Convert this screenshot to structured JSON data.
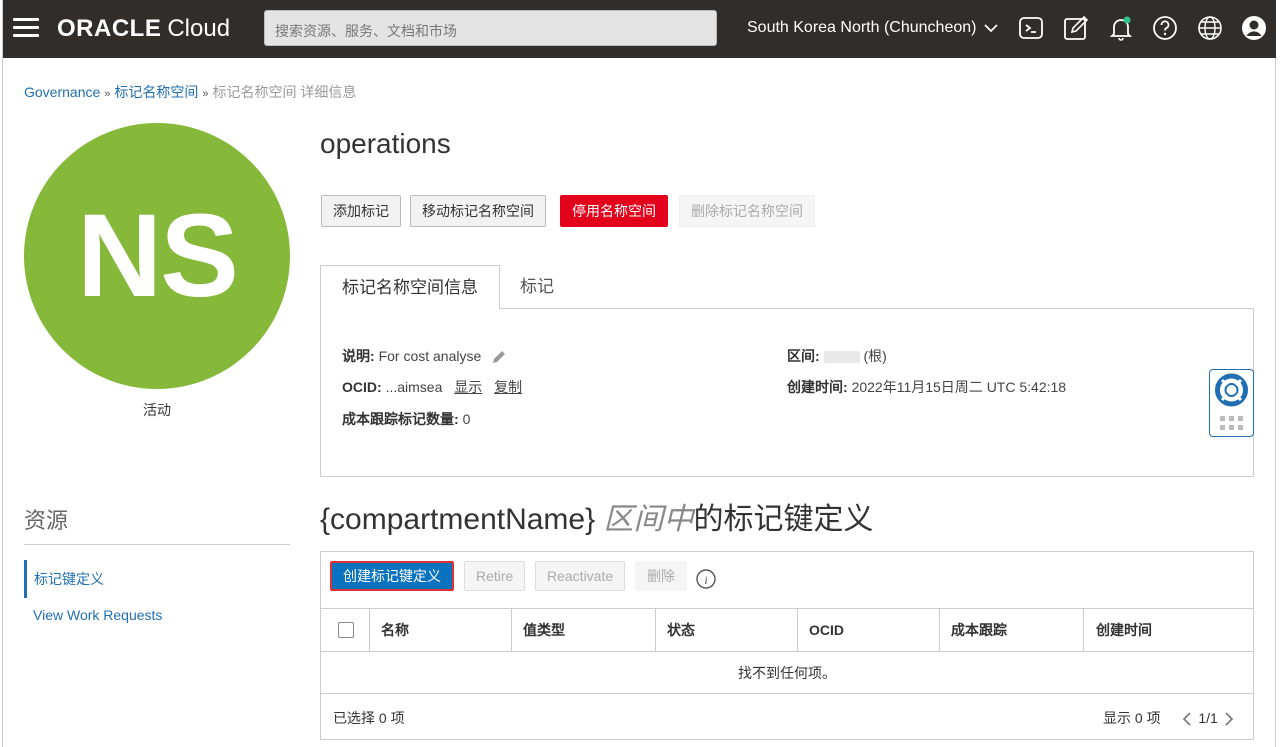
{
  "header": {
    "brand_bold": "ORACLE",
    "brand_light": "Cloud",
    "search_placeholder": "搜索资源、服务、文档和市场",
    "region": "South Korea North (Chuncheon)"
  },
  "breadcrumb": {
    "item1": "Governance",
    "item2": "标记名称空间",
    "current": "标记名称空间 详细信息"
  },
  "avatar": {
    "initials": "NS",
    "status": "活动",
    "color": "#86b83a"
  },
  "resources": {
    "title": "资源",
    "items": [
      "标记键定义",
      "View Work Requests"
    ]
  },
  "page": {
    "title": "operations",
    "buttons": {
      "add_tag": "添加标记",
      "move": "移动标记名称空间",
      "retire": "停用名称空间",
      "delete": "删除标记名称空间"
    },
    "tabs": [
      "标记名称空间信息",
      "标记"
    ]
  },
  "info": {
    "desc_label": "说明:",
    "desc_value": "For cost analyse",
    "ocid_label": "OCID:",
    "ocid_value": "...aimsea",
    "ocid_show": "显示",
    "ocid_copy": "复制",
    "cost_label": "成本跟踪标记数量:",
    "cost_value": "0",
    "compartment_label": "区间:",
    "compartment_value": "(根)",
    "created_label": "创建时间:",
    "created_value": "2022年11月15日周二 UTC 5:42:18"
  },
  "section": {
    "prefix": "{compartmentName}",
    "italic": "区间中",
    "suffix": "的标记键定义"
  },
  "table": {
    "buttons": {
      "create": "创建标记键定义",
      "retire": "Retire",
      "reactivate": "Reactivate",
      "delete": "删除"
    },
    "columns": [
      "名称",
      "值类型",
      "状态",
      "OCID",
      "成本跟踪",
      "创建时间"
    ],
    "empty_text": "找不到任何项。",
    "selected": "已选择 0 项",
    "showing": "显示 0 项",
    "page": "1/1"
  }
}
